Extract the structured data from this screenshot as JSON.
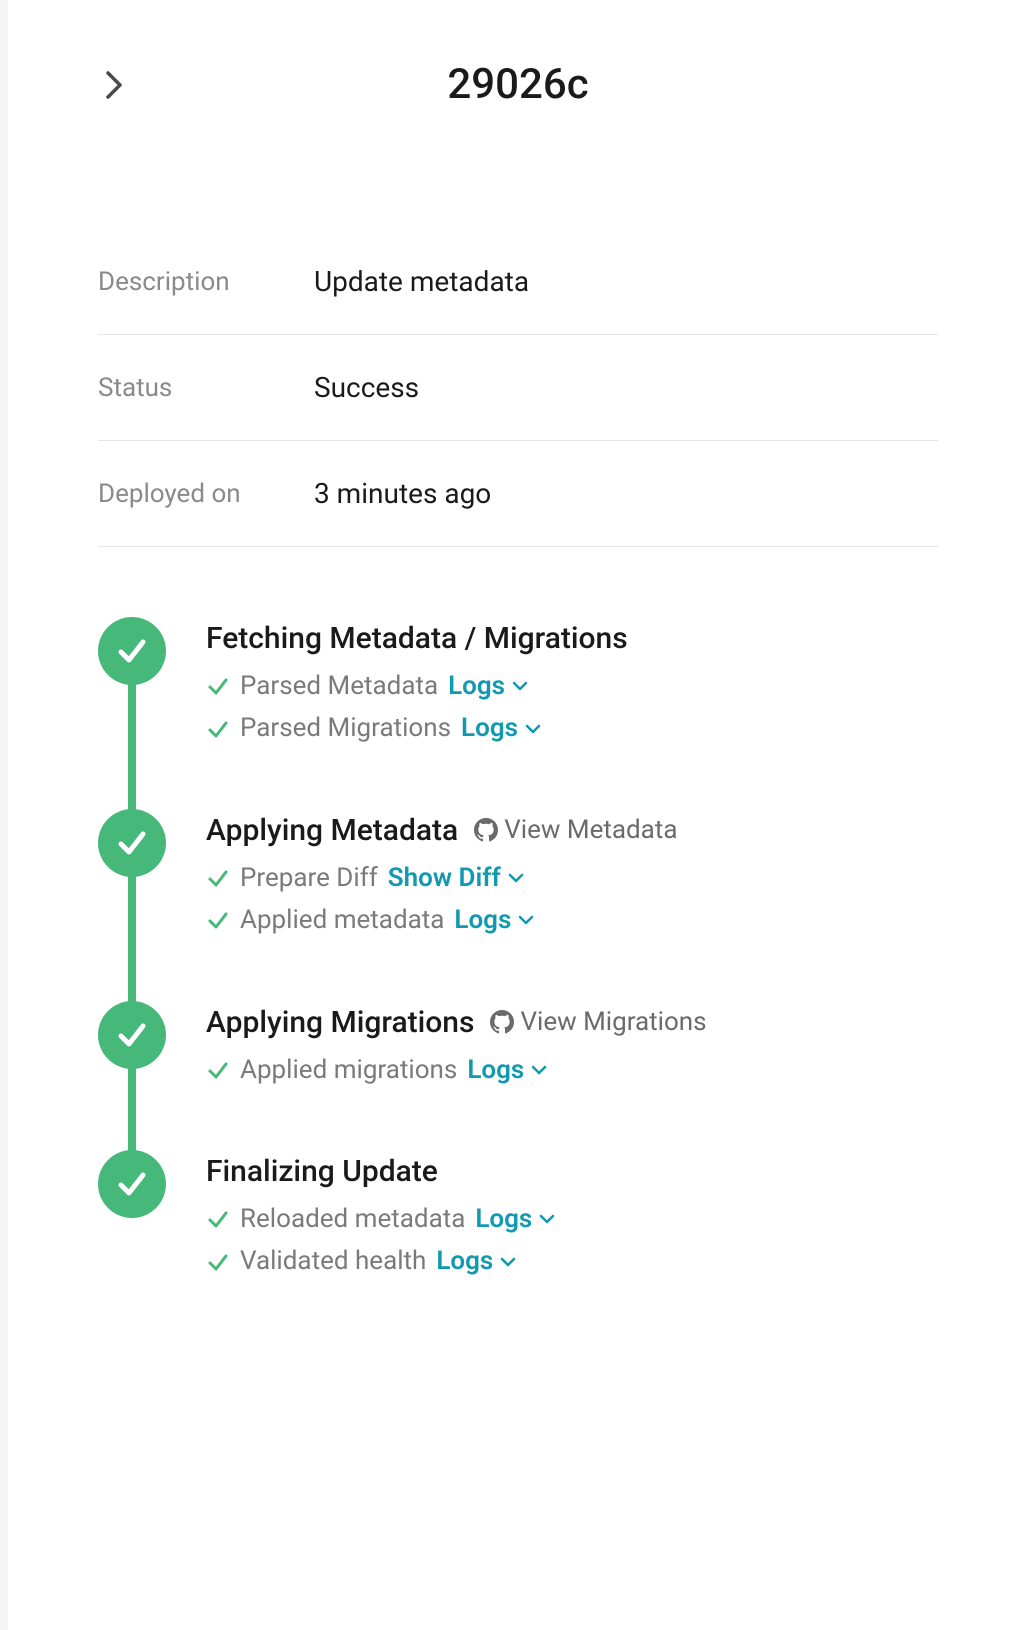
{
  "header": {
    "title": "29026c"
  },
  "meta": {
    "description_label": "Description",
    "description_value": "Update metadata",
    "status_label": "Status",
    "status_value": "Success",
    "deployed_label": "Deployed on",
    "deployed_value": "3 minutes ago"
  },
  "colors": {
    "success": "#45b87a",
    "accent": "#1099b0"
  },
  "steps": [
    {
      "title": "Fetching Metadata / Migrations",
      "external": null,
      "subs": [
        {
          "label": "Parsed Metadata",
          "action": "Logs"
        },
        {
          "label": "Parsed Migrations",
          "action": "Logs"
        }
      ]
    },
    {
      "title": "Applying Metadata",
      "external": "View Metadata",
      "subs": [
        {
          "label": "Prepare Diff",
          "action": "Show Diff"
        },
        {
          "label": "Applied metadata",
          "action": "Logs"
        }
      ]
    },
    {
      "title": "Applying Migrations",
      "external": "View Migrations",
      "subs": [
        {
          "label": "Applied migrations",
          "action": "Logs"
        }
      ]
    },
    {
      "title": "Finalizing Update",
      "external": null,
      "subs": [
        {
          "label": "Reloaded metadata",
          "action": "Logs"
        },
        {
          "label": "Validated health",
          "action": "Logs"
        }
      ]
    }
  ]
}
